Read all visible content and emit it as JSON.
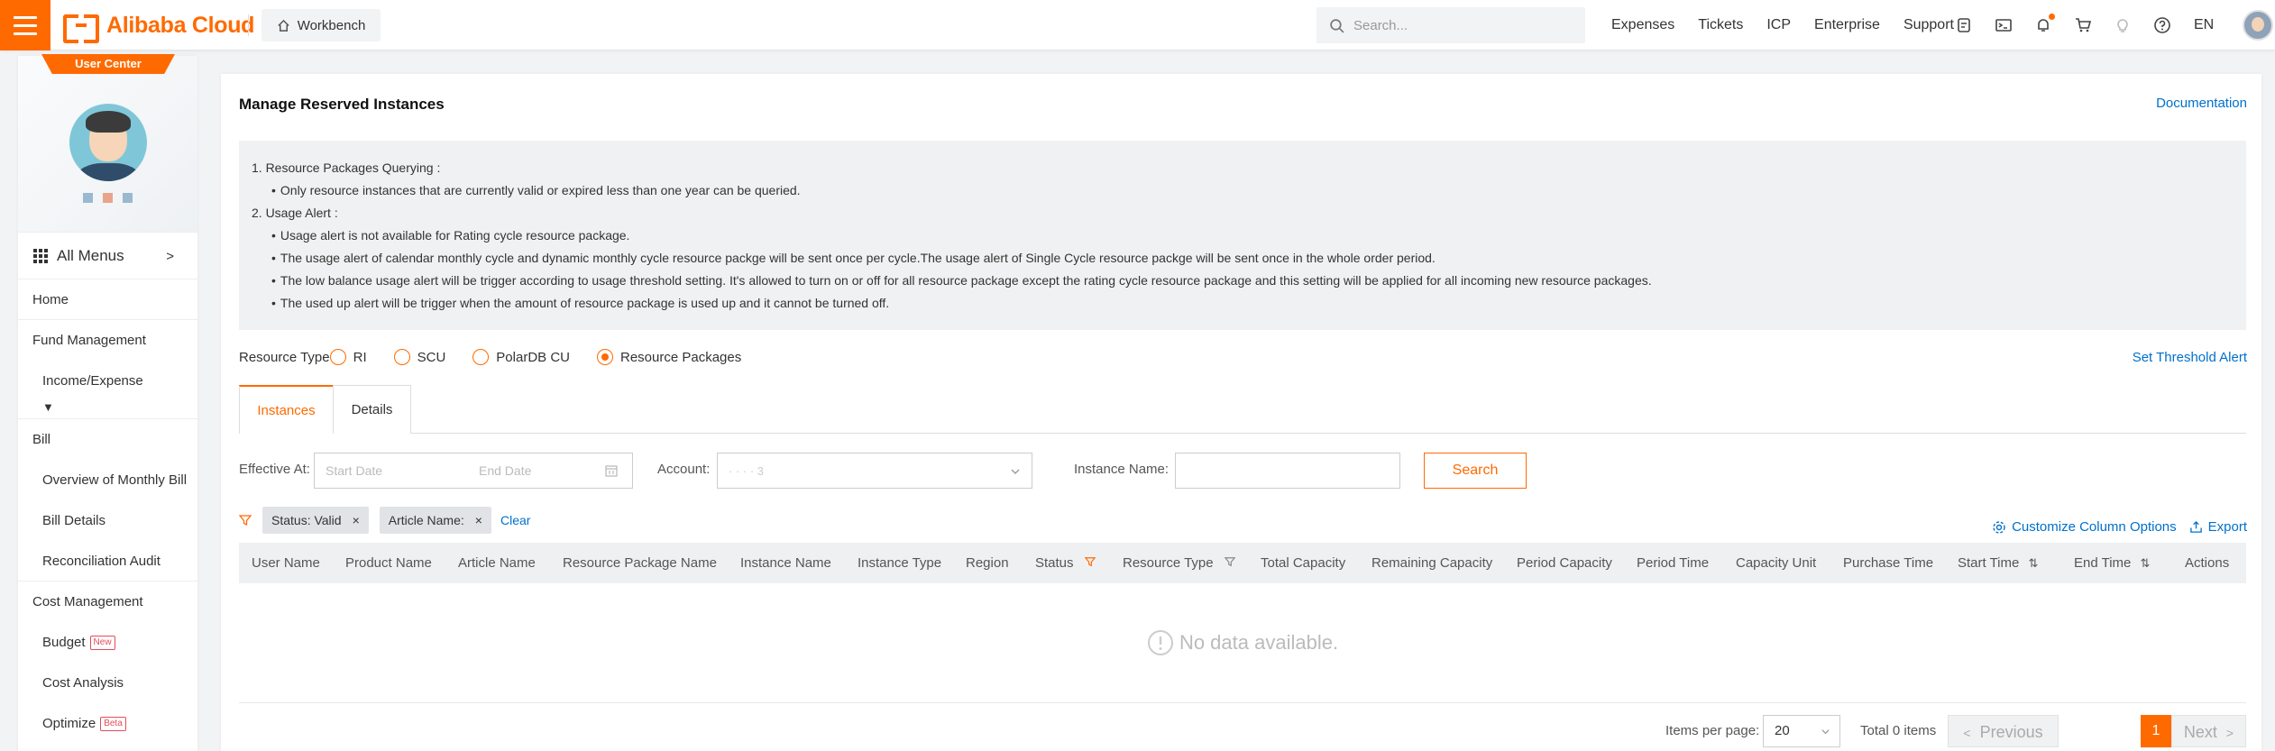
{
  "header": {
    "brand": "Alibaba Cloud",
    "workbench": "Workbench",
    "search_placeholder": "Search...",
    "links": [
      "Expenses",
      "Tickets",
      "ICP",
      "Enterprise",
      "Support"
    ],
    "language": "EN",
    "accent_color": "#ff6a00"
  },
  "sidebar": {
    "user_center": "User Center",
    "all_menus": "All Menus",
    "home": "Home",
    "fund_management": "Fund Management",
    "income_expense": "Income/Expense",
    "bill": "Bill",
    "overview_monthly_bill": "Overview of Monthly Bill",
    "bill_details": "Bill Details",
    "reconciliation_audit": "Reconciliation Audit",
    "cost_management": "Cost Management",
    "budget": "Budget",
    "budget_badge": "New",
    "cost_analysis": "Cost Analysis",
    "optimize": "Optimize",
    "optimize_badge": "Beta"
  },
  "main": {
    "title": "Manage Reserved Instances",
    "documentation": "Documentation",
    "notice": {
      "h1": "1. Resource Packages Querying :",
      "h1_items": [
        "Only resource instances that are currently valid or expired less than one year can be queried."
      ],
      "h2": "2. Usage Alert :",
      "h2_items": [
        "Usage alert is not available for Rating cycle resource package.",
        "The usage alert of calendar monthly cycle and dynamic monthly cycle resource packge will be sent once per cycle.The usage alert of Single Cycle resource packge will be sent once in the whole order period.",
        "The low balance usage alert will be trigger according to usage threshold setting. It's allowed to turn on or off for all resource package except the rating cycle resource package and this setting will be applied for all incoming new resource packages.",
        "The used up alert will be trigger when the amount of resource package is used up and it cannot be turned off."
      ]
    },
    "resource_type_label": "Resource Type",
    "resource_types": [
      "RI",
      "SCU",
      "PolarDB CU",
      "Resource Packages"
    ],
    "selected_resource_type": "Resource Packages",
    "set_threshold": "Set Threshold Alert",
    "tabs": [
      "Instances",
      "Details"
    ],
    "active_tab": "Instances",
    "filters": {
      "effective_at": "Effective At:",
      "start_placeholder": "Start Date",
      "end_placeholder": "End Date",
      "account": "Account:",
      "account_value": "· · · · 3",
      "instance_name": "Instance Name:",
      "instance_name_value": "",
      "search": "Search"
    },
    "active_filters": [
      "Status: Valid",
      "Article Name:"
    ],
    "clear": "Clear",
    "customize_columns": "Customize Column Options",
    "export": "Export",
    "columns": [
      "User Name",
      "Product Name",
      "Article Name",
      "Resource Package Name",
      "Instance Name",
      "Instance Type",
      "Region",
      "Status",
      "Resource Type",
      "Total Capacity",
      "Remaining Capacity",
      "Period Capacity",
      "Period Time",
      "Capacity Unit",
      "Purchase Time",
      "Start Time",
      "End Time",
      "Actions"
    ],
    "empty_text": "No data available.",
    "pagination": {
      "items_per_page_label": "Items per page:",
      "items_per_page": "20",
      "total": "Total 0 items",
      "previous": "Previous",
      "current_page": "1",
      "next": "Next"
    }
  }
}
